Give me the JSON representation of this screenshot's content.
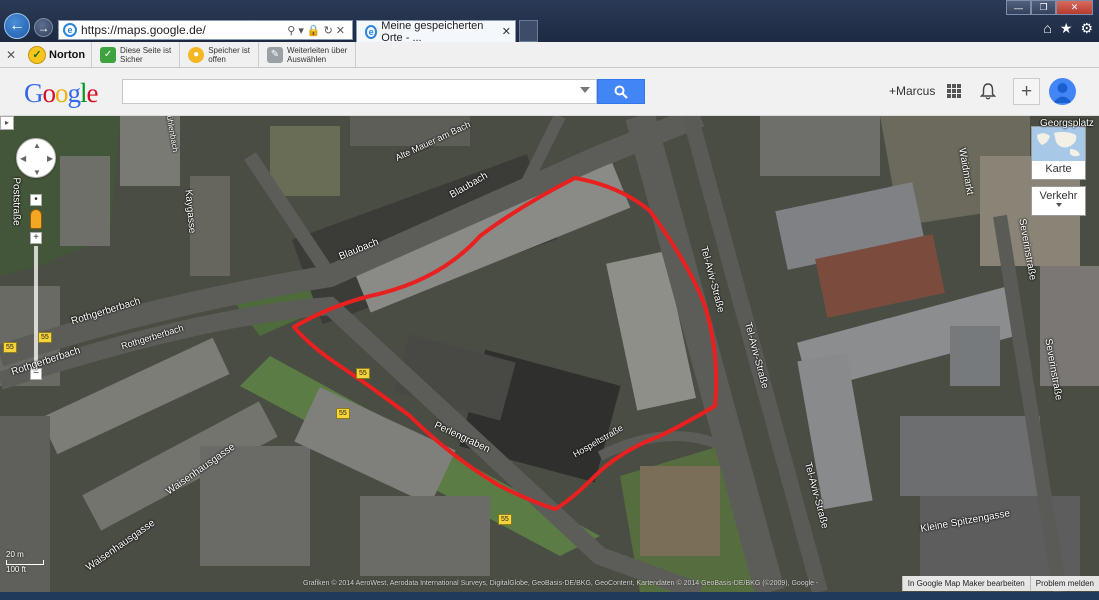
{
  "browser": {
    "url": "https://maps.google.de/",
    "tab_title": "Meine gespeicherten Orte - ...",
    "icons": [
      "back-arrow-icon",
      "forward-arrow-icon",
      "search-icon",
      "lock-icon",
      "refresh-icon",
      "home-icon",
      "star-icon",
      "gear-icon"
    ]
  },
  "toolbar": {
    "brand": "Norton",
    "items": [
      {
        "line1": "Diese Seite ist",
        "line2": "Sicher"
      },
      {
        "line1": "Speicher ist",
        "line2": "offen"
      },
      {
        "line1": "Weiterleiten über",
        "line2": "Auswählen"
      }
    ]
  },
  "header": {
    "logo": "Google",
    "search_value": "",
    "user": "+Marcus",
    "plus": "+"
  },
  "map": {
    "streets": [
      "Rothgerberbach",
      "Rothgerberbach",
      "Rothgerberbach",
      "Blaubach",
      "Blaubach",
      "Alte Mauer am Bach",
      "Perlengraben",
      "Tel-Aviv-Straße",
      "Tel-Aviv-Straße",
      "Tel-Aviv-Straße",
      "Kleine Spitzengasse",
      "Waisenhausgasse",
      "Waisenhausgasse",
      "Severinstraße",
      "Severinstraße",
      "Poststraße",
      "Kaygasse",
      "Georgsplatz",
      "Waidmarkt",
      "Mühlenbach",
      "Hospeltstraße"
    ],
    "routes": [
      "55",
      "55",
      "55",
      "55",
      "55"
    ],
    "map_type": "Karte",
    "traffic": "Verkehr",
    "scale_m": "20 m",
    "scale_ft": "100 ft",
    "copyright": "Grafiken © 2014 AeroWest, Aerodata International Surveys, DigitalGlobe, GeoBasis-DE/BKG, GeoContent, Kartendaten © 2014 GeoBasis-DE/BKG (©2009), Google -",
    "footer_links": [
      "In Google Map Maker bearbeiten",
      "Problem melden"
    ],
    "colors": {
      "polygon": "#e8201f",
      "aerial": "#4a4d44"
    }
  }
}
